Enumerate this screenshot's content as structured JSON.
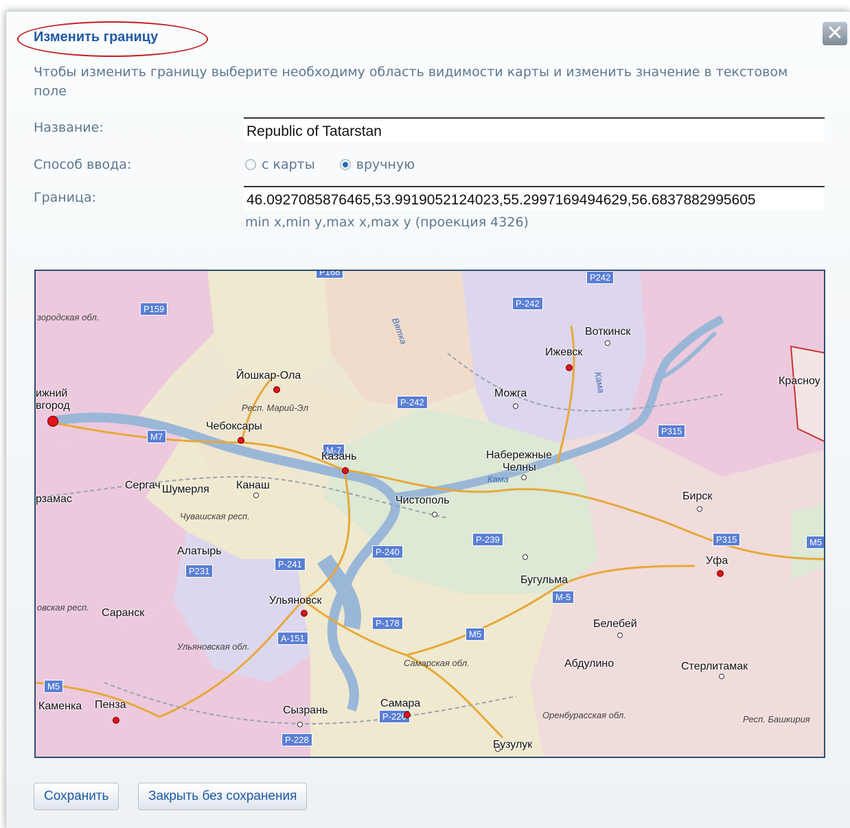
{
  "dialog": {
    "title": "Изменить границу",
    "description": "Чтобы изменить границу выберите необходиму область видимости карты и изменить значение в текстовом поле"
  },
  "form": {
    "name_label": "Название:",
    "name_value": "Republic of Tatarstan",
    "input_method_label": "Способ ввода:",
    "input_methods": [
      {
        "label": "с карты",
        "checked": false
      },
      {
        "label": "вручную",
        "checked": true
      }
    ],
    "border_label": "Граница:",
    "border_value": "46.0927085876465,53.9919052124023,55.2997169494629,56.6837882995605",
    "border_hint": "min x,min y,max x,max y (проекция 4326)"
  },
  "map": {
    "cities": [
      "Воткинск",
      "Ижевск",
      "Йошкар-Ола",
      "Можга",
      "Красноу",
      "ижний",
      "вгород",
      "Чебоксары",
      "Казань",
      "Набережные",
      "Челны",
      "Сергач",
      "Шумерля",
      "Канаш",
      "Чистополь",
      "Бирск",
      "рзамас",
      "Алатырь",
      "Уфа",
      "Бугульма",
      "Ульяновск",
      "Саранск",
      "Белебей",
      "Абдулино",
      "Стерлитамак",
      "Каменка",
      "Пенза",
      "Сызрань",
      "Самара",
      "Бузулук"
    ],
    "regions": [
      "зородская обл.",
      "Респ. Марий-Эл",
      "Чувашская респ.",
      "овская респ.",
      "Ульяновская обл.",
      "Самарская обл.",
      "Оренбурасская обл.",
      "Респ. Башкирия"
    ],
    "rivers": [
      "Вятка",
      "Кама",
      "Кама"
    ],
    "roads": [
      "Р159",
      "Р242",
      "Р-242",
      "Р-242",
      "М7",
      "М-7",
      "Р315",
      "Р315",
      "Р-239",
      "Р-240",
      "Р-241",
      "Р231",
      "М-5",
      "М5",
      "Р-178",
      "А-151",
      "М5",
      "М5",
      "Р-226",
      "Р-228",
      "Р168"
    ]
  },
  "buttons": {
    "save": "Сохранить",
    "close_without_save": "Закрыть без сохранения"
  },
  "icons": {
    "close": "close-icon"
  }
}
